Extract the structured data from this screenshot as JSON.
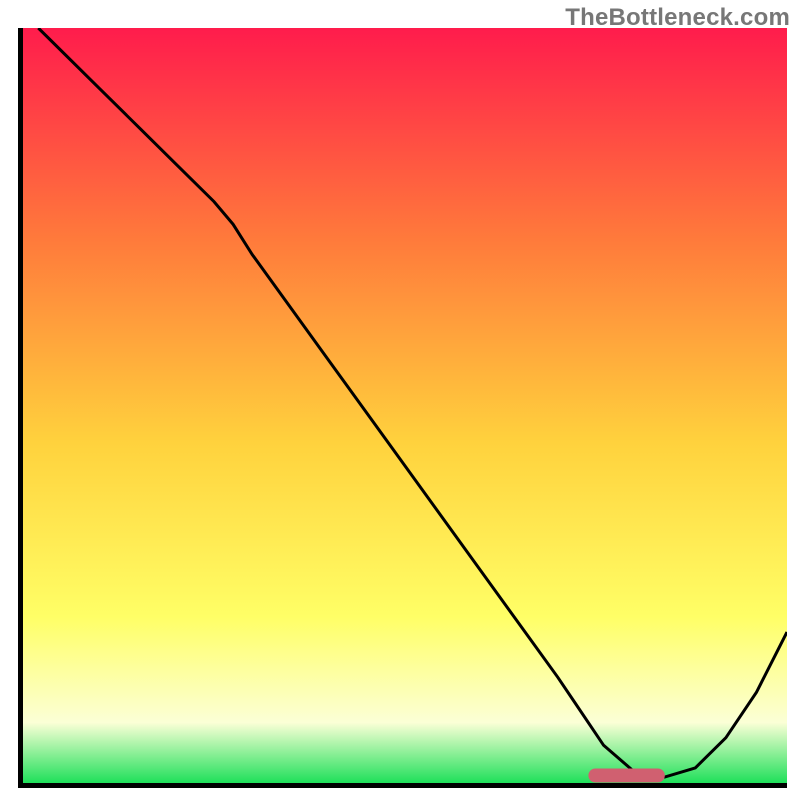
{
  "watermark": {
    "text": "TheBottleneck.com"
  },
  "colors": {
    "top": "#ff1c4c",
    "upper_mid": "#ff7a3b",
    "mid": "#ffd23d",
    "lower_mid": "#ffff66",
    "pale": "#fbffd6",
    "green": "#1fe05a",
    "curve": "#000000",
    "marker": "#d06070",
    "axis": "#000000"
  },
  "chart_data": {
    "type": "line",
    "title": "",
    "xlabel": "",
    "ylabel": "",
    "xlim": [
      0,
      100
    ],
    "ylim": [
      0,
      100
    ],
    "x": [
      2,
      10,
      20,
      25,
      27.5,
      30,
      40,
      50,
      60,
      70,
      72,
      76,
      80,
      82,
      84,
      88,
      92,
      96,
      100
    ],
    "values": [
      100,
      92,
      82,
      77,
      74,
      70,
      56,
      42,
      28,
      14,
      11,
      5,
      1.5,
      0.8,
      0.8,
      2,
      6,
      12,
      20
    ],
    "marker_xrange": [
      74,
      84
    ],
    "marker_y": 1,
    "grid": false,
    "legend": null
  }
}
